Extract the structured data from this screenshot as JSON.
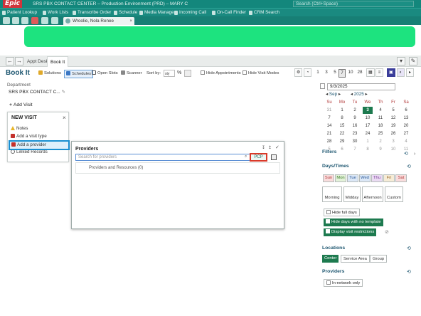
{
  "title_bar": {
    "logo": "Epic",
    "title": "SRS PBX CONTACT CENTER – Production Environment (PRD) – MARY C",
    "search_placeholder": "Search (Ctrl+Space)"
  },
  "toolbar": {
    "items": [
      "Patient Lookup",
      "Work Lists",
      "Transcribe Order",
      "Schedule",
      "Media Manager",
      "Incoming Call",
      "On-Call Finder",
      "CRM Search"
    ]
  },
  "patient_tab": {
    "name": "Wroolie, Nola Renee"
  },
  "activity_tabs": [
    "Appt Desk",
    "Book It"
  ],
  "book_it": {
    "title": "Book It",
    "tools": [
      "Solutions",
      "Schedules",
      "Open Slots",
      "Scanner"
    ],
    "sort_by_label": "Sort by:",
    "sort_value": "sty",
    "hide_appointments": "Hide Appointments",
    "hide_visit_modes": "Hide Visit Modes",
    "day_counts": [
      "1",
      "3",
      "5",
      "7",
      "10",
      "28"
    ],
    "selected_day_count": "7"
  },
  "department": {
    "label": "Department",
    "value": "SRS PBX CONTACT C..."
  },
  "add_visit": "Add Visit",
  "new_visit": {
    "title": "NEW VISIT",
    "items": [
      "Notes",
      "Add a visit type",
      "Add a provider",
      "Linked Records"
    ]
  },
  "providers_panel": {
    "title": "Providers",
    "search_placeholder": "Search for providers",
    "pcp_label": "PCP",
    "result_text": "Providers and Resources (0)"
  },
  "calendar": {
    "date_value": "9/3/2025",
    "month": "Sep",
    "year": "2025",
    "day_headers": [
      "Su",
      "Mo",
      "Tu",
      "We",
      "Th",
      "Fr",
      "Sa"
    ],
    "weeks": [
      [
        "31",
        "1",
        "2",
        "3",
        "4",
        "5",
        "6"
      ],
      [
        "7",
        "8",
        "9",
        "10",
        "11",
        "12",
        "13"
      ],
      [
        "14",
        "15",
        "16",
        "17",
        "18",
        "19",
        "20"
      ],
      [
        "21",
        "22",
        "23",
        "24",
        "25",
        "26",
        "27"
      ],
      [
        "28",
        "29",
        "30",
        "1",
        "2",
        "3",
        "4"
      ],
      [
        "5",
        "6",
        "7",
        "8",
        "9",
        "10",
        "11"
      ]
    ],
    "today": "3"
  },
  "filters": {
    "title": "Filters",
    "days_times": "Days/Times",
    "days": [
      "Sun",
      "Mon",
      "Tue",
      "Wed",
      "Thu",
      "Fri",
      "Sat"
    ],
    "times": [
      "Morning",
      "Midday",
      "Afternoon",
      "Custom"
    ],
    "hide_full_days": "Hide full days",
    "hide_no_template": "Hide days with no template",
    "display_restrictions": "Display visit restrictions",
    "locations": "Locations",
    "location_opts": [
      "Center",
      "Service Area",
      "Group"
    ],
    "providers": "Providers",
    "in_network": "In-network only"
  }
}
